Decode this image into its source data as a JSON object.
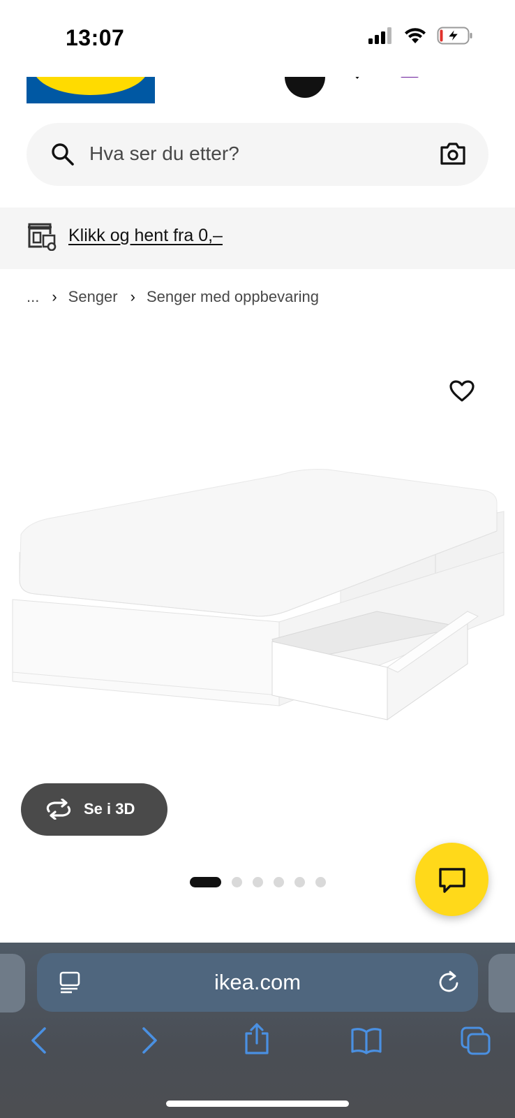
{
  "status_bar": {
    "time": "13:07"
  },
  "search": {
    "placeholder": "Hva ser du etter?"
  },
  "promo": {
    "text": "Klikk og hent fra 0,–"
  },
  "breadcrumb": {
    "items": [
      "...",
      "Senger",
      "Senger med oppbevaring"
    ]
  },
  "product": {
    "view3d_label": "Se i 3D",
    "carousel_total": 6,
    "carousel_active_index": 0
  },
  "browser": {
    "url": "ikea.com"
  },
  "colors": {
    "brand_blue": "#0058a3",
    "brand_yellow": "#ffdb00",
    "chat_yellow": "#ffd91a",
    "safari_icon_blue": "#4a90e2"
  },
  "icons": [
    "signal-icon",
    "wifi-icon",
    "battery-charging-icon",
    "search-icon",
    "camera-icon",
    "store-icon",
    "heart-icon",
    "rotate-3d-icon",
    "chat-icon",
    "reader-icon",
    "reload-icon",
    "back-icon",
    "forward-icon",
    "share-icon",
    "bookmarks-icon",
    "tabs-icon"
  ]
}
